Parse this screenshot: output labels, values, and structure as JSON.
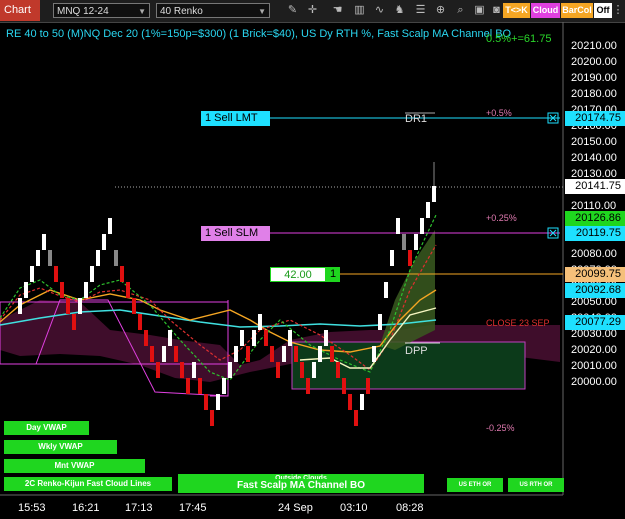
{
  "toolbar": {
    "chart_tab": "Chart",
    "instrument": "MNQ 12-24",
    "bar_type": "40 Renko",
    "tk_label": "T<>K",
    "cloud_label": "Cloud",
    "barcol_label": "BarCol",
    "off_label": "Off",
    "icons": [
      "pencil-icon",
      "crosshair-icon",
      "hand-icon",
      "chart-style-icon",
      "indicators-icon",
      "strategy-icon",
      "properties-icon",
      "zoom-icon",
      "magnifier-icon",
      "data-box-icon",
      "list-icon",
      "camera-icon"
    ]
  },
  "chart": {
    "title": "RE 40 to 50 (M)NQ Dec 20 (1%=150p=$300) (1 Brick=$40), US Dy RTH %, Fast Scalp MA Channel BO",
    "top_right_value": "0.5%+=61.75",
    "price_axis": [
      "20210.00",
      "20200.00",
      "20190.00",
      "20180.00",
      "20170.00",
      "20160.00",
      "20150.00",
      "20140.00",
      "20130.00",
      "20120.00",
      "20110.00",
      "20100.00",
      "20090.00",
      "20080.00",
      "20070.00",
      "20060.00",
      "20050.00",
      "20040.00",
      "20030.00",
      "20020.00",
      "20010.00",
      "20000.00"
    ],
    "time_axis": [
      "15:53",
      "16:21",
      "17:13",
      "17:45",
      "24 Sep",
      "03:10",
      "08:28"
    ],
    "price_labels": {
      "sell_lmt": "20174.75",
      "current": "20141.75",
      "level_126": "20126.86",
      "sell_slm": "20119.75",
      "level_099": "20099.75",
      "level_092": "20092.68",
      "level_077": "20077.29"
    },
    "orders": {
      "sell_lmt": "1 Sell LMT",
      "sell_slm": "1 Sell SLM",
      "qty_value": "42.00",
      "qty_count": "1"
    },
    "annotations": {
      "dr1": "DR1",
      "dpp": "DPP",
      "plus_05": "+0.5%",
      "plus_025": "+0.25%",
      "minus_025": "-0.25%",
      "close": "CLOSE 23 SEP"
    },
    "green_bars": {
      "day_vwap": "Day VWAP",
      "wkly_vwap": "Wkly VWAP",
      "mnt_vwap": "Mnt VWAP",
      "renko_cloud": "2C Renko-Kijun Fast Cloud Lines",
      "fast_scalp": "Fast Scalp MA Channel BO",
      "outside_clouds": "Outside Clouds",
      "us_eth": "US ETH OR",
      "us_rth": "US RTH OR"
    },
    "colors": {
      "background": "#000000",
      "up_brick": "#ffffff",
      "down_brick": "#e01010",
      "accent_cyan": "#1ee0ff",
      "accent_magenta": "#e040e0",
      "label_green": "#1fd61f",
      "label_orange": "#f5a623"
    }
  }
}
